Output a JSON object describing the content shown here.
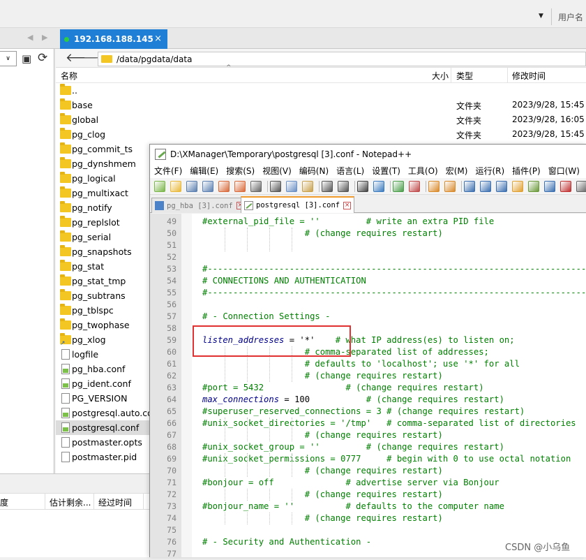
{
  "topbar": {
    "username_label": "用户名"
  },
  "session_tab": {
    "label": "192.168.188.145",
    "close": "×"
  },
  "remote": {
    "path": "/data/pgdata/data",
    "columns": {
      "name": "名称",
      "size": "大小",
      "type": "类型",
      "mtime": "修改时间"
    },
    "rows": [
      {
        "name": "..",
        "kind": "folder",
        "type": "",
        "mtime": ""
      },
      {
        "name": "base",
        "kind": "folder",
        "type": "文件夹",
        "mtime": "2023/9/28, 15:45"
      },
      {
        "name": "global",
        "kind": "folder",
        "type": "文件夹",
        "mtime": "2023/9/28, 16:05"
      },
      {
        "name": "pg_clog",
        "kind": "folder",
        "type": "文件夹",
        "mtime": "2023/9/28, 15:45"
      },
      {
        "name": "pg_commit_ts",
        "kind": "folder",
        "type": "",
        "mtime": ""
      },
      {
        "name": "pg_dynshmem",
        "kind": "folder",
        "type": "",
        "mtime": ""
      },
      {
        "name": "pg_logical",
        "kind": "folder",
        "type": "",
        "mtime": ""
      },
      {
        "name": "pg_multixact",
        "kind": "folder",
        "type": "",
        "mtime": ""
      },
      {
        "name": "pg_notify",
        "kind": "folder",
        "type": "",
        "mtime": ""
      },
      {
        "name": "pg_replslot",
        "kind": "folder",
        "type": "",
        "mtime": ""
      },
      {
        "name": "pg_serial",
        "kind": "folder",
        "type": "",
        "mtime": ""
      },
      {
        "name": "pg_snapshots",
        "kind": "folder",
        "type": "",
        "mtime": ""
      },
      {
        "name": "pg_stat",
        "kind": "folder",
        "type": "",
        "mtime": ""
      },
      {
        "name": "pg_stat_tmp",
        "kind": "folder",
        "type": "",
        "mtime": ""
      },
      {
        "name": "pg_subtrans",
        "kind": "folder",
        "type": "",
        "mtime": ""
      },
      {
        "name": "pg_tblspc",
        "kind": "folder",
        "type": "",
        "mtime": ""
      },
      {
        "name": "pg_twophase",
        "kind": "folder",
        "type": "",
        "mtime": ""
      },
      {
        "name": "pg_xlog",
        "kind": "folder-link",
        "type": "",
        "mtime": ""
      },
      {
        "name": "logfile",
        "kind": "file",
        "type": "",
        "mtime": ""
      },
      {
        "name": "pg_hba.conf",
        "kind": "conf",
        "type": "",
        "mtime": ""
      },
      {
        "name": "pg_ident.conf",
        "kind": "conf",
        "type": "",
        "mtime": ""
      },
      {
        "name": "PG_VERSION",
        "kind": "file",
        "type": "",
        "mtime": ""
      },
      {
        "name": "postgresql.auto.conf",
        "kind": "conf",
        "type": "",
        "mtime": ""
      },
      {
        "name": "postgresql.conf",
        "kind": "conf",
        "type": "",
        "mtime": "",
        "selected": true
      },
      {
        "name": "postmaster.opts",
        "kind": "file",
        "type": "",
        "mtime": ""
      },
      {
        "name": "postmaster.pid",
        "kind": "file",
        "type": "",
        "mtime": ""
      }
    ]
  },
  "transfer": {
    "col_progress": "度",
    "col_remaining": "估计剩余...",
    "col_elapsed": "经过时间"
  },
  "npp": {
    "title": "D:\\XManager\\Temporary\\postgresql [3].conf - Notepad++",
    "menu": [
      "文件(F)",
      "编辑(E)",
      "搜索(S)",
      "视图(V)",
      "编码(N)",
      "语言(L)",
      "设置(T)",
      "工具(O)",
      "宏(M)",
      "运行(R)",
      "插件(P)",
      "窗口(W)"
    ],
    "tabs": [
      {
        "label": "pg_hba [3].conf",
        "active": false
      },
      {
        "label": "postgresql [3].conf",
        "active": true
      }
    ],
    "lines": [
      {
        "n": "49",
        "t": "#external_pid_file = ''         # write an extra PID file"
      },
      {
        "n": "50",
        "t": "                    # (change requires restart)"
      },
      {
        "n": "51",
        "t": ""
      },
      {
        "n": "52",
        "t": ""
      },
      {
        "n": "53",
        "t": "#------------------------------------------------------------------------------"
      },
      {
        "n": "54",
        "t": "# CONNECTIONS AND AUTHENTICATION"
      },
      {
        "n": "55",
        "t": "#------------------------------------------------------------------------------"
      },
      {
        "n": "56",
        "t": ""
      },
      {
        "n": "57",
        "t": "# - Connection Settings -"
      },
      {
        "n": "58",
        "t": ""
      },
      {
        "n": "59",
        "kw": "listen_addresses",
        "v": " = '*'",
        "c": "    # what IP address(es) to listen on;"
      },
      {
        "n": "60",
        "t": "                    # comma-separated list of addresses;"
      },
      {
        "n": "61",
        "t": "                    # defaults to 'localhost'; use '*' for all"
      },
      {
        "n": "62",
        "t": "                    # (change requires restart)"
      },
      {
        "n": "63",
        "t": "#port = 5432                # (change requires restart)"
      },
      {
        "n": "64",
        "kw": "max_connections",
        "v": " = 100",
        "c": "           # (change requires restart)"
      },
      {
        "n": "65",
        "t": "#superuser_reserved_connections = 3 # (change requires restart)"
      },
      {
        "n": "66",
        "t": "#unix_socket_directories = '/tmp'   # comma-separated list of directories"
      },
      {
        "n": "67",
        "t": "                    # (change requires restart)"
      },
      {
        "n": "68",
        "t": "#unix_socket_group = ''         # (change requires restart)"
      },
      {
        "n": "69",
        "t": "#unix_socket_permissions = 0777     # begin with 0 to use octal notation"
      },
      {
        "n": "70",
        "t": "                    # (change requires restart)"
      },
      {
        "n": "71",
        "t": "#bonjour = off              # advertise server via Bonjour"
      },
      {
        "n": "72",
        "t": "                    # (change requires restart)"
      },
      {
        "n": "73",
        "t": "#bonjour_name = ''          # defaults to the computer name"
      },
      {
        "n": "74",
        "t": "                    # (change requires restart)"
      },
      {
        "n": "75",
        "t": ""
      },
      {
        "n": "76",
        "t": "# - Security and Authentication -"
      },
      {
        "n": "77",
        "t": ""
      }
    ]
  },
  "watermark": "CSDN @小乌鱼",
  "colors": {
    "accent_tab": "#1f7fd6",
    "highlight_box": "#e03030",
    "comment": "#008000",
    "keyword": "#00008b"
  }
}
